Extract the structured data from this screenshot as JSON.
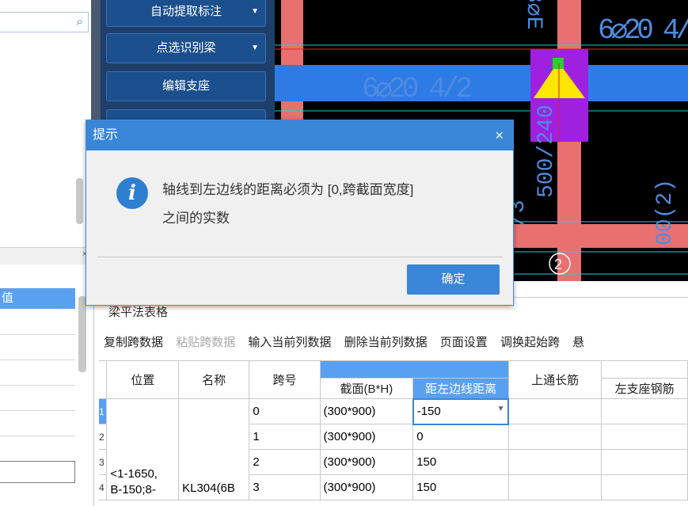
{
  "left_panel": {
    "search_placeholder": "",
    "close_symbol": "×",
    "property_header": "值"
  },
  "toolbar": {
    "items": [
      {
        "label": "自动提取标注",
        "arrow": "▼"
      },
      {
        "label": "点选识别梁",
        "arrow": "▼"
      },
      {
        "label": "编辑支座",
        "arrow": ""
      }
    ]
  },
  "cad": {
    "texts": [
      "6⌀20 4/2",
      "6⌀20 4/",
      "8⌀E",
      "500/240",
      "00(2)",
      "/3",
      "2"
    ]
  },
  "table_panel": {
    "title": "梁平法表格",
    "toolbar": [
      "复制跨数据",
      "粘贴跨数据",
      "输入当前列数据",
      "删除当前列数据",
      "页面设置",
      "调换起始跨",
      "悬"
    ],
    "disabled_index": 1,
    "headers": {
      "position": "位置",
      "name": "名称",
      "span": "跨号",
      "section": "截面(B*H)",
      "axis_dist": "距左边线距离",
      "top_long": "上通长筋",
      "left_support": "左支座钢筋"
    },
    "rows": [
      {
        "no": "1",
        "span": "0",
        "section": "(300*900)",
        "dist": "-150"
      },
      {
        "no": "2",
        "span": "1",
        "section": "(300*900)",
        "dist": "0"
      },
      {
        "no": "3",
        "span": "2",
        "section": "(300*900)",
        "dist": "150"
      },
      {
        "no": "4",
        "span": "3",
        "section": "(300*900)",
        "dist": "150"
      }
    ],
    "position_text": "<1-1650,\nB-150;8-",
    "name_text": "KL304(6B"
  },
  "dialog": {
    "title": "提示",
    "close": "×",
    "message_line1": "轴线到左边线的距离必须为 [0,跨截面宽度]",
    "message_line2": "之间的实数",
    "ok_label": "确定",
    "icon": "info-icon"
  },
  "colors": {
    "accent": "#3a86d8",
    "toolbar_bg": "#1f3e6a",
    "cad_beam_blue": "#2f7be6",
    "cad_column_red": "#e87070",
    "cad_magenta": "#a020e0",
    "cad_yellow": "#ffe600",
    "cad_text": "#4f8be0"
  }
}
